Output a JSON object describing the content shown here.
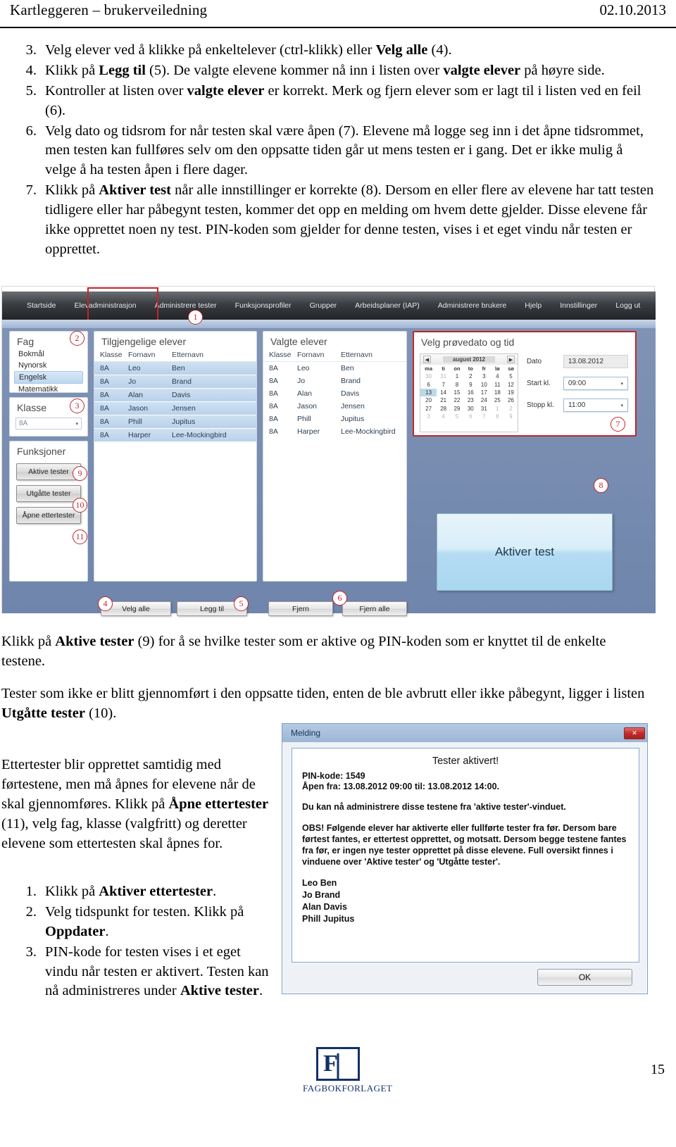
{
  "header": {
    "title": "Kartleggeren – brukerveiledning",
    "date": "02.10.2013"
  },
  "instructions": [
    {
      "num": "3.",
      "html": "Velg elever ved å klikke på enkeltelever (ctrl-klikk) eller <b>Velg alle</b> (4)."
    },
    {
      "num": "4.",
      "html": "Klikk på <b>Legg til</b> (5). De valgte elevene kommer nå inn i listen over <b>valgte elever</b> på høyre side."
    },
    {
      "num": "5.",
      "html": "Kontroller at listen over <b>valgte elever</b> er korrekt. Merk og fjern elever som er lagt til i listen ved en feil (6)."
    },
    {
      "num": "6.",
      "html": "Velg dato og tidsrom for når testen skal være åpen (7). Elevene må logge seg inn i det åpne tidsrommet, men testen kan fullføres selv om den oppsatte tiden går ut mens testen er i gang. Det er ikke mulig å velge å ha testen åpen i flere dager."
    },
    {
      "num": "7.",
      "html": "Klikk på <b>Aktiver test</b> når alle innstillinger er korrekte (8). Dersom en eller flere av elevene har tatt testen tidligere eller har påbegynt testen, kommer det opp en melding om hvem dette gjelder. Disse elevene får ikke opprettet noen ny test. PIN-koden som gjelder for denne testen, vises i et eget vindu når testen er opprettet."
    }
  ],
  "app": {
    "nav": [
      "Startside",
      "Elevadministrasjon",
      "Administrere tester",
      "Funksjonsprofiler",
      "Grupper",
      "Arbeidsplaner (IAP)",
      "Administrere brukere",
      "Hjelp",
      "Innstillinger",
      "Logg ut"
    ],
    "nav_active": "Administrere tester",
    "sidebar": {
      "fag_title": "Fag",
      "fag_items": [
        "Bokmål",
        "Nynorsk",
        "Engelsk",
        "Matematikk"
      ],
      "fag_selected": "Engelsk",
      "klasse_title": "Klasse",
      "klasse_value": "8A",
      "funksjoner_title": "Funksjoner",
      "funksjoner_buttons": [
        "Aktive tester",
        "Utgåtte tester",
        "Åpne ettertester"
      ]
    },
    "available": {
      "title": "Tilgjengelige elever",
      "columns": [
        "Klasse",
        "Fornavn",
        "Etternavn"
      ],
      "rows": [
        [
          "8A",
          "Leo",
          "Ben"
        ],
        [
          "8A",
          "Jo",
          "Brand"
        ],
        [
          "8A",
          "Alan",
          "Davis"
        ],
        [
          "8A",
          "Jason",
          "Jensen"
        ],
        [
          "8A",
          "Phill",
          "Jupitus"
        ],
        [
          "8A",
          "Harper",
          "Lee-Mockingbird"
        ]
      ]
    },
    "chosen": {
      "title": "Valgte elever",
      "columns": [
        "Klasse",
        "Fornavn",
        "Etternavn"
      ],
      "rows": [
        [
          "8A",
          "Leo",
          "Ben"
        ],
        [
          "8A",
          "Jo",
          "Brand"
        ],
        [
          "8A",
          "Alan",
          "Davis"
        ],
        [
          "8A",
          "Jason",
          "Jensen"
        ],
        [
          "8A",
          "Phill",
          "Jupitus"
        ],
        [
          "8A",
          "Harper",
          "Lee-Mockingbird"
        ]
      ]
    },
    "datepanel": {
      "title": "Velg prøvedato og tid",
      "month_label": "august 2012",
      "prev_icon": "◀",
      "next_icon": "▶",
      "weekdays": [
        "ma",
        "ti",
        "on",
        "to",
        "fr",
        "lø",
        "sø"
      ],
      "weeks": [
        [
          "30",
          "31",
          "1",
          "2",
          "3",
          "4",
          "5"
        ],
        [
          "6",
          "7",
          "8",
          "9",
          "10",
          "11",
          "12"
        ],
        [
          "13",
          "14",
          "15",
          "16",
          "17",
          "18",
          "19"
        ],
        [
          "20",
          "21",
          "22",
          "23",
          "24",
          "25",
          "26"
        ],
        [
          "27",
          "28",
          "29",
          "30",
          "31",
          "1",
          "2"
        ],
        [
          "3",
          "4",
          "5",
          "6",
          "7",
          "8",
          "9"
        ]
      ],
      "dim_cells": [
        "0-0",
        "0-1",
        "4-5",
        "4-6",
        "5-0",
        "5-1",
        "5-2",
        "5-3",
        "5-4",
        "5-5",
        "5-6"
      ],
      "selected_cell": "2-0",
      "date_label": "Dato",
      "date_value": "13.08.2012",
      "start_label": "Start kl.",
      "start_value": "09:00",
      "stop_label": "Stopp kl.",
      "stop_value": "11:00"
    },
    "aktiver_test_label": "Aktiver test",
    "action_buttons": {
      "velg_alle": "Velg alle",
      "legg_til": "Legg til",
      "fjern": "Fjern",
      "fjern_alle": "Fjern alle"
    },
    "markers": [
      "1",
      "2",
      "3",
      "4",
      "5",
      "6",
      "7",
      "8",
      "9",
      "10",
      "11"
    ],
    "highlight_color": "#c0262c"
  },
  "paragraphs": {
    "p1": "Klikk på <b>Aktive tester</b> (9) for å se hvilke tester som er aktive og PIN-koden som er knyttet til de enkelte testene.",
    "p2": "Tester som ikke er blitt gjennomført i den oppsatte tiden, enten de ble avbrutt eller ikke påbegynt, ligger i listen <b>Utgåtte tester</b> (10).",
    "p3": "Ettertester blir opprettet samtidig med førtestene, men må åpnes for elevene når de skal gjennomføres. Klikk på <b>Åpne ettertester</b> (11), velg fag, klasse (valgfritt) og deretter elevene som ettertesten skal åpnes for."
  },
  "sublist": [
    {
      "num": "1.",
      "html": "Klikk på <b>Aktiver ettertester</b>."
    },
    {
      "num": "2.",
      "html": "Velg tidspunkt for testen. Klikk på <b>Oppdater</b>."
    },
    {
      "num": "3.",
      "html": "PIN-kode for testen vises i et eget vindu når testen er aktivert. Testen kan nå administreres under <b>Aktive tester</b>."
    }
  ],
  "dialog": {
    "title": "Melding",
    "close_icon": "✕",
    "heading": "Tester aktivert!",
    "pin_line": "PIN-kode: 1549",
    "open_line": "Åpen fra: 13.08.2012 09:00 til: 13.08.2012 14:00.",
    "para1": "Du kan nå administrere disse testene fra 'aktive tester'-vinduet.",
    "para2": "OBS! Følgende elever har aktiverte eller fullførte tester fra før. Dersom bare førtest fantes, er ettertest opprettet, og motsatt. Dersom begge testene fantes fra før, er ingen nye tester opprettet på disse elevene. Full oversikt finnes i vinduene over 'Aktive tester' og 'Utgåtte tester'.",
    "names": [
      "Leo Ben",
      "Jo Brand",
      "Alan Davis",
      "Phill Jupitus"
    ],
    "ok_label": "OK"
  },
  "footer": {
    "logo_text": "FAGBOKFORLAGET",
    "page_number": "15"
  }
}
